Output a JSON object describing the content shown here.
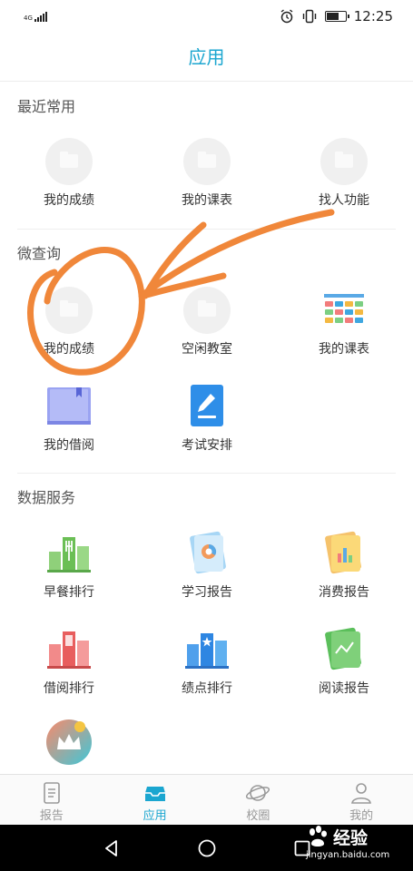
{
  "status_bar": {
    "network": "4G",
    "time": "12:25"
  },
  "header": {
    "title": "应用"
  },
  "sections": {
    "recent": {
      "title": "最近常用",
      "items": [
        {
          "label": "我的成绩",
          "icon": "folder-icon"
        },
        {
          "label": "我的课表",
          "icon": "folder-icon"
        },
        {
          "label": "找人功能",
          "icon": "folder-icon"
        }
      ]
    },
    "query": {
      "title": "微查询",
      "items": [
        {
          "label": "我的成绩",
          "icon": "folder-icon"
        },
        {
          "label": "空闲教室",
          "icon": "folder-icon"
        },
        {
          "label": "我的课表",
          "icon": "timetable-icon"
        },
        {
          "label": "我的借阅",
          "icon": "book-icon"
        },
        {
          "label": "考试安排",
          "icon": "exam-edit-icon"
        }
      ]
    },
    "data": {
      "title": "数据服务",
      "items": [
        {
          "label": "早餐排行",
          "icon": "breakfast-ranking-icon"
        },
        {
          "label": "学习报告",
          "icon": "study-report-icon"
        },
        {
          "label": "消费报告",
          "icon": "consumption-report-icon"
        },
        {
          "label": "借阅排行",
          "icon": "borrow-ranking-icon"
        },
        {
          "label": "绩点排行",
          "icon": "gpa-ranking-icon"
        },
        {
          "label": "阅读报告",
          "icon": "reading-report-icon"
        },
        {
          "label": "",
          "icon": "crown-icon"
        }
      ]
    }
  },
  "bottom_nav": {
    "tabs": [
      {
        "label": "报告",
        "icon": "report-icon"
      },
      {
        "label": "应用",
        "icon": "app-tray-icon",
        "active": true
      },
      {
        "label": "校圈",
        "icon": "planet-icon"
      },
      {
        "label": "我的",
        "icon": "user-icon"
      }
    ]
  },
  "watermark": {
    "brand": "经验",
    "url": "jingyan.baidu.com"
  },
  "colors": {
    "accent": "#1ba6d0",
    "annotation": "#f0873a",
    "inactive": "#999999"
  }
}
